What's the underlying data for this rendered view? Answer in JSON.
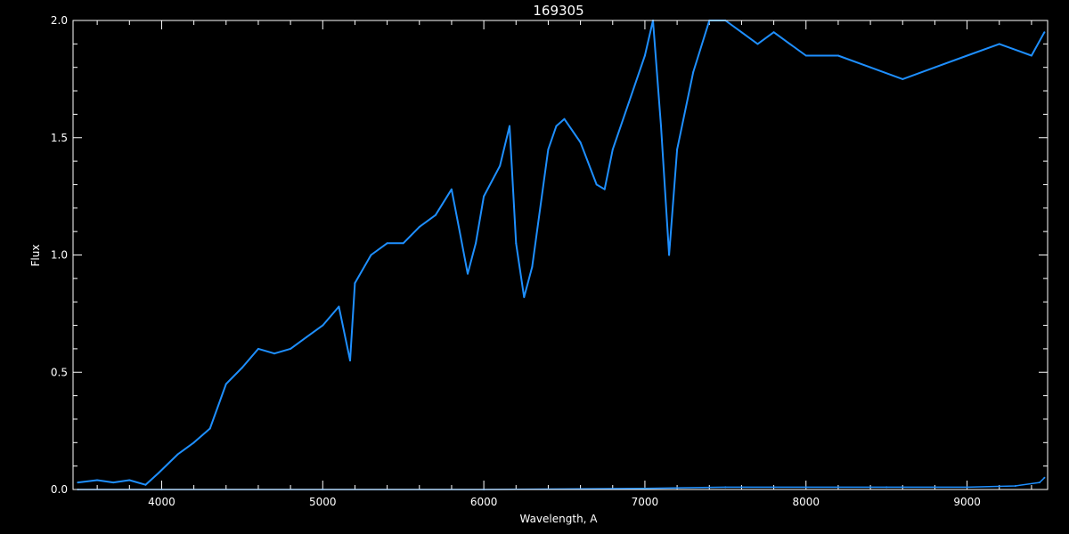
{
  "chart_data": {
    "type": "line",
    "title": "169305",
    "xlabel": "Wavelength, A",
    "ylabel": "Flux",
    "xlim": [
      3450,
      9500
    ],
    "ylim": [
      0.0,
      2.0
    ],
    "xticks": [
      4000,
      5000,
      6000,
      7000,
      8000,
      9000
    ],
    "xtick_labels": [
      "4000",
      "5000",
      "6000",
      "7000",
      "8000",
      "9000"
    ],
    "yticks": [
      0.0,
      0.5,
      1.0,
      1.5,
      2.0
    ],
    "ytick_labels": [
      "0.0",
      "0.5",
      "1.0",
      "1.5",
      "2.0"
    ],
    "grid": false,
    "series": [
      {
        "color": "#1e8fff",
        "x": [
          3480,
          3600,
          3700,
          3800,
          3900,
          3980,
          4100,
          4200,
          4300,
          4400,
          4500,
          4600,
          4700,
          4800,
          4900,
          5000,
          5100,
          5170,
          5200,
          5300,
          5400,
          5500,
          5600,
          5700,
          5800,
          5850,
          5900,
          5950,
          6000,
          6100,
          6160,
          6200,
          6250,
          6300,
          6400,
          6450,
          6500,
          6600,
          6700,
          6750,
          6800,
          6900,
          7000,
          7050,
          7100,
          7150,
          7200,
          7300,
          7400,
          7500,
          7600,
          7700,
          7800,
          7900,
          8000,
          8200,
          8400,
          8600,
          8800,
          9000,
          9200,
          9400,
          9480
        ],
        "y": [
          0.03,
          0.04,
          0.03,
          0.04,
          0.02,
          0.07,
          0.15,
          0.2,
          0.26,
          0.45,
          0.52,
          0.6,
          0.58,
          0.6,
          0.65,
          0.7,
          0.78,
          0.55,
          0.88,
          1.0,
          1.05,
          1.05,
          1.12,
          1.17,
          1.28,
          1.1,
          0.92,
          1.05,
          1.25,
          1.38,
          1.55,
          1.05,
          0.82,
          0.95,
          1.45,
          1.55,
          1.58,
          1.48,
          1.3,
          1.28,
          1.45,
          1.65,
          1.85,
          2.0,
          1.55,
          1.0,
          1.45,
          1.78,
          2.0,
          2.0,
          1.95,
          1.9,
          1.95,
          1.9,
          1.85,
          1.85,
          1.8,
          1.75,
          1.8,
          1.85,
          1.9,
          1.85,
          1.95
        ]
      },
      {
        "color": "#1e8fff",
        "x": [
          3480,
          4000,
          5000,
          6000,
          7000,
          7500,
          8000,
          8500,
          9000,
          9300,
          9450,
          9480
        ],
        "y": [
          0.0,
          0.0,
          0.0,
          0.0,
          0.005,
          0.01,
          0.01,
          0.01,
          0.01,
          0.015,
          0.03,
          0.05
        ]
      }
    ]
  }
}
